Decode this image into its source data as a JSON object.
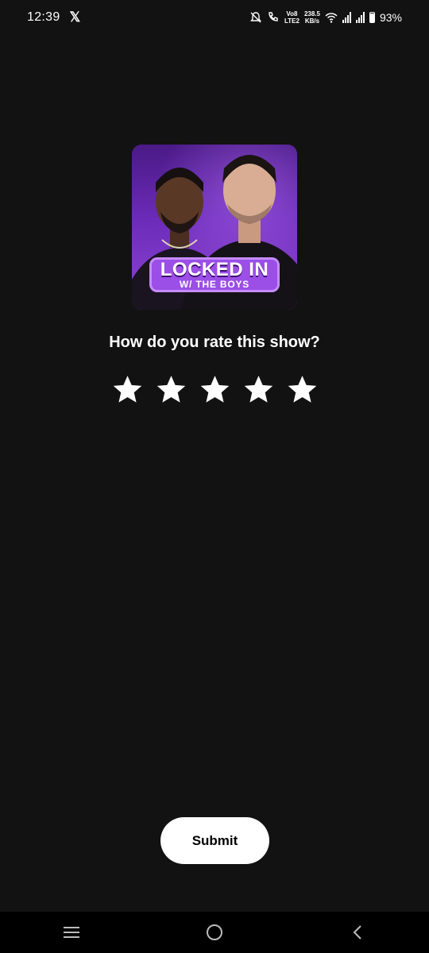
{
  "status_bar": {
    "time": "12:39",
    "x_app": "𝕏",
    "net_top": "Vo8",
    "net_bottom": "LTE2",
    "speed_value": "238.5",
    "speed_unit": "KB/s",
    "battery": "93%"
  },
  "cover": {
    "title_main": "LOCKED IN",
    "title_sub": "W/ THE BOYS"
  },
  "rating": {
    "question": "How do you rate this show?",
    "stars_max": 5,
    "stars_selected": 0
  },
  "submit_label": "Submit",
  "colors": {
    "background": "#121212",
    "cover_purple": "#6b2bb8",
    "button": "#ffffff"
  }
}
